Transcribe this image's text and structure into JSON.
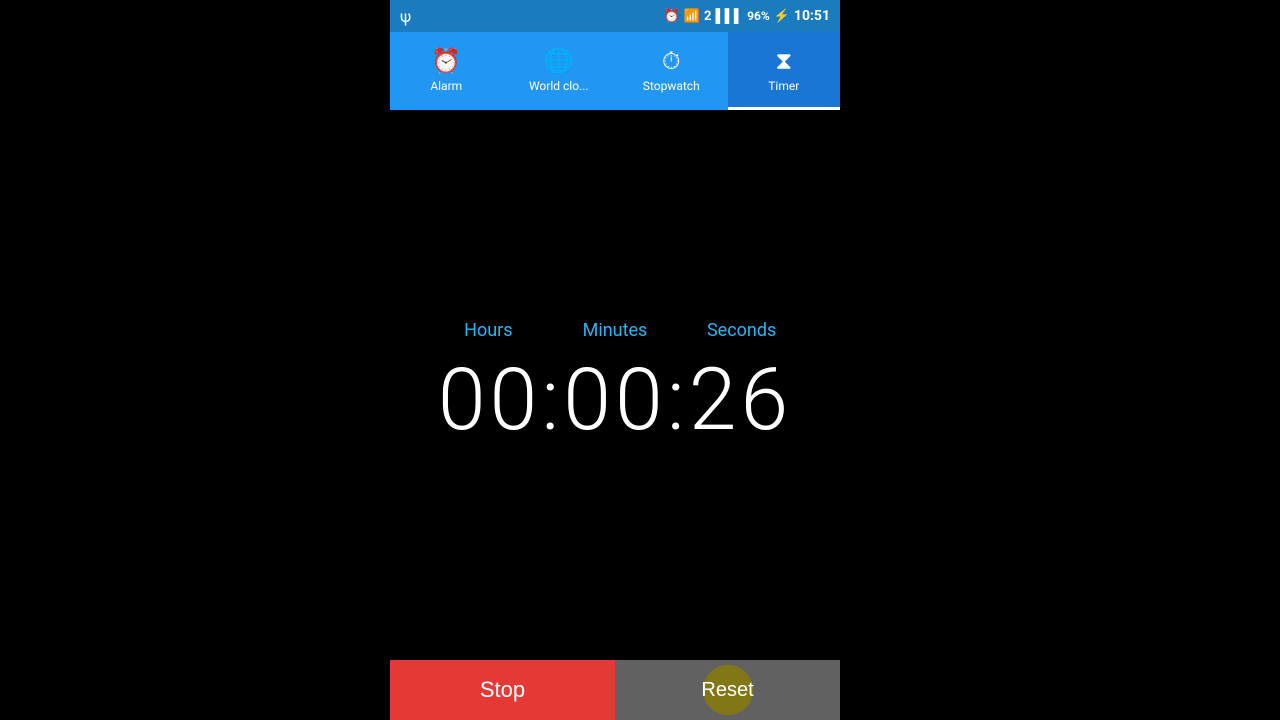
{
  "statusBar": {
    "time": "10:51",
    "battery": "96%",
    "usbIcon": "⚡",
    "usbSymbol": "ψ"
  },
  "tabs": [
    {
      "id": "alarm",
      "label": "Alarm",
      "icon": "⏰",
      "active": false
    },
    {
      "id": "worldclock",
      "label": "World clo...",
      "icon": "🌐",
      "active": false
    },
    {
      "id": "stopwatch",
      "label": "Stopwatch",
      "icon": "⏱",
      "active": false
    },
    {
      "id": "timer",
      "label": "Timer",
      "icon": "⧗",
      "active": true
    }
  ],
  "timer": {
    "hoursLabel": "Hours",
    "minutesLabel": "Minutes",
    "secondsLabel": "Seconds",
    "display": "00:00:26"
  },
  "buttons": {
    "stop": "Stop",
    "reset": "Reset"
  }
}
